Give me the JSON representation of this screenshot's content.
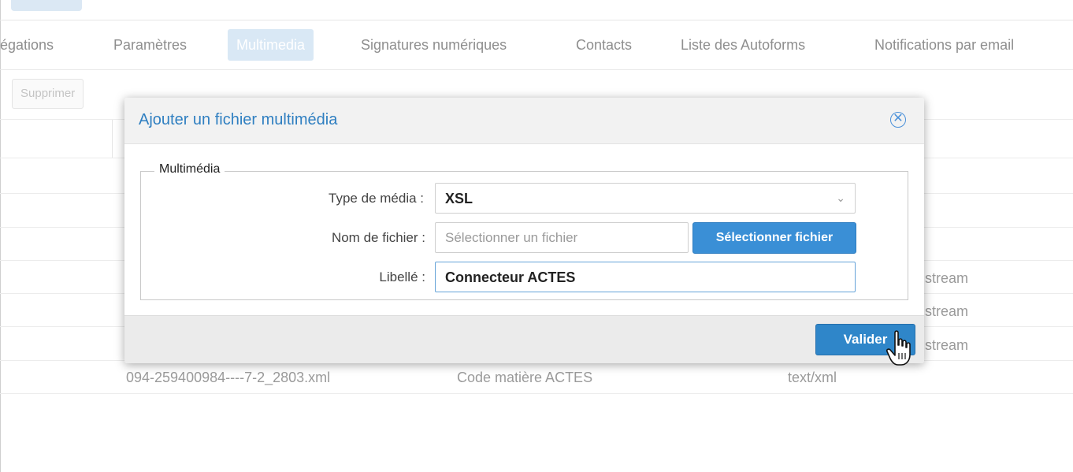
{
  "tabs": [
    {
      "label": "égations",
      "active": false
    },
    {
      "label": "Paramètres",
      "active": false
    },
    {
      "label": "Multimedia",
      "active": true
    },
    {
      "label": "Signatures numériques",
      "active": false
    },
    {
      "label": "Contacts",
      "active": false
    },
    {
      "label": "Liste des Autoforms",
      "active": false
    },
    {
      "label": "Notifications par email",
      "active": false
    }
  ],
  "toolbar": {
    "delete_label": "Supprimer"
  },
  "table": {
    "rows": [
      {
        "type": "stream"
      },
      {
        "type": "stream"
      },
      {
        "type": "stream"
      },
      {
        "file": "094-259400984----7-2_2803.xml",
        "label": "Code matière ACTES",
        "type": "text/xml"
      }
    ]
  },
  "modal": {
    "title": "Ajouter un fichier multimédia",
    "close_icon": "close-circle-icon",
    "fieldset_legend": "Multimédia",
    "fields": {
      "media_type_label": "Type de média :",
      "media_type_value": "XSL",
      "file_name_label": "Nom de fichier :",
      "file_name_placeholder": "Sélectionner un fichier",
      "select_file_button": "Sélectionner fichier",
      "libelle_label": "Libellé :",
      "libelle_value": "Connecteur ACTES"
    },
    "submit_label": "Valider"
  },
  "colors": {
    "accent": "#2f86c9",
    "active_tab_bg": "#d9e8f5",
    "title_blue": "#2f7fc1"
  }
}
